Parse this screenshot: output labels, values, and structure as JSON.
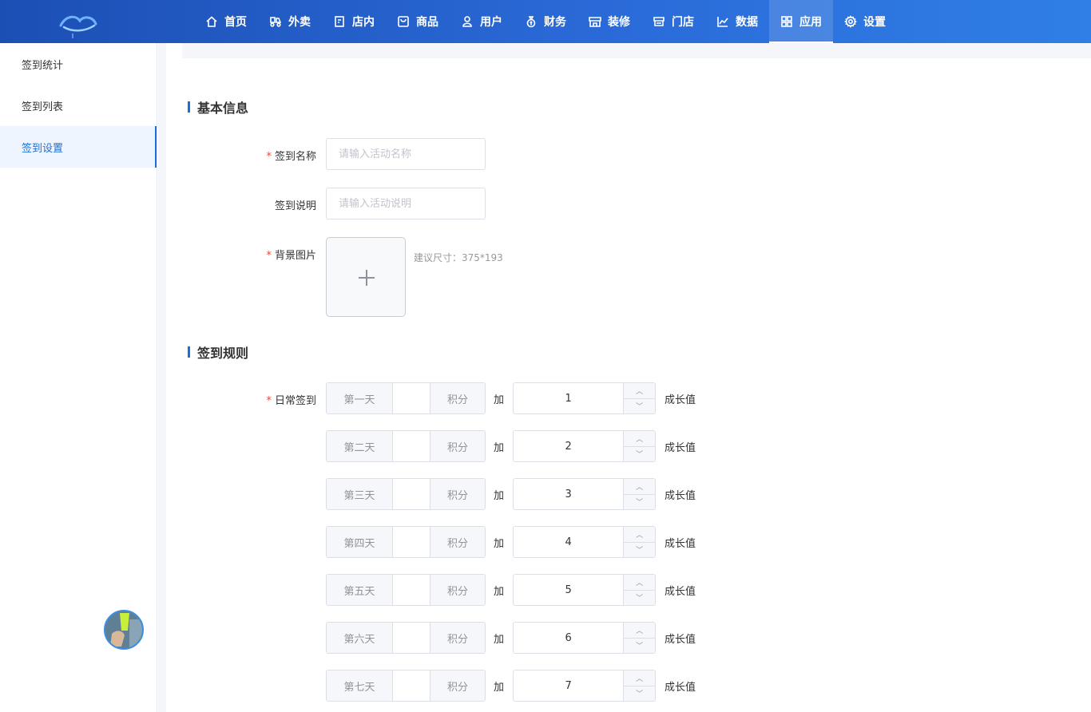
{
  "nav": {
    "items": [
      {
        "label": "首页",
        "icon": "home-icon"
      },
      {
        "label": "外卖",
        "icon": "delivery-icon"
      },
      {
        "label": "店内",
        "icon": "dine-in-icon"
      },
      {
        "label": "商品",
        "icon": "goods-icon"
      },
      {
        "label": "用户",
        "icon": "user-icon"
      },
      {
        "label": "财务",
        "icon": "money-bag-icon"
      },
      {
        "label": "装修",
        "icon": "storefront-icon"
      },
      {
        "label": "门店",
        "icon": "store-icon"
      },
      {
        "label": "数据",
        "icon": "chart-icon"
      },
      {
        "label": "应用",
        "icon": "apps-icon"
      },
      {
        "label": "设置",
        "icon": "gear-icon"
      }
    ],
    "active": "应用"
  },
  "sidebar": {
    "items": [
      {
        "label": "签到统计"
      },
      {
        "label": "签到列表"
      },
      {
        "label": "签到设置"
      }
    ],
    "active": "签到设置"
  },
  "basic_info": {
    "title": "基本信息",
    "name_label": "签到名称",
    "name_placeholder": "请输入活动名称",
    "desc_label": "签到说明",
    "desc_placeholder": "请输入活动说明",
    "bg_label": "背景图片",
    "bg_hint": "建议尺寸：375*193"
  },
  "rules": {
    "title": "签到规则",
    "daily_label": "日常签到",
    "points_suffix": "积分",
    "add_text": "加",
    "growth_text": "成长值",
    "days": [
      {
        "day": "第一天",
        "growth": "1"
      },
      {
        "day": "第二天",
        "growth": "2"
      },
      {
        "day": "第三天",
        "growth": "3"
      },
      {
        "day": "第四天",
        "growth": "4"
      },
      {
        "day": "第五天",
        "growth": "5"
      },
      {
        "day": "第六天",
        "growth": "6"
      },
      {
        "day": "第七天",
        "growth": "7"
      }
    ]
  },
  "colors": {
    "brand": "#1d6fd8",
    "required": "#e64a3b"
  }
}
